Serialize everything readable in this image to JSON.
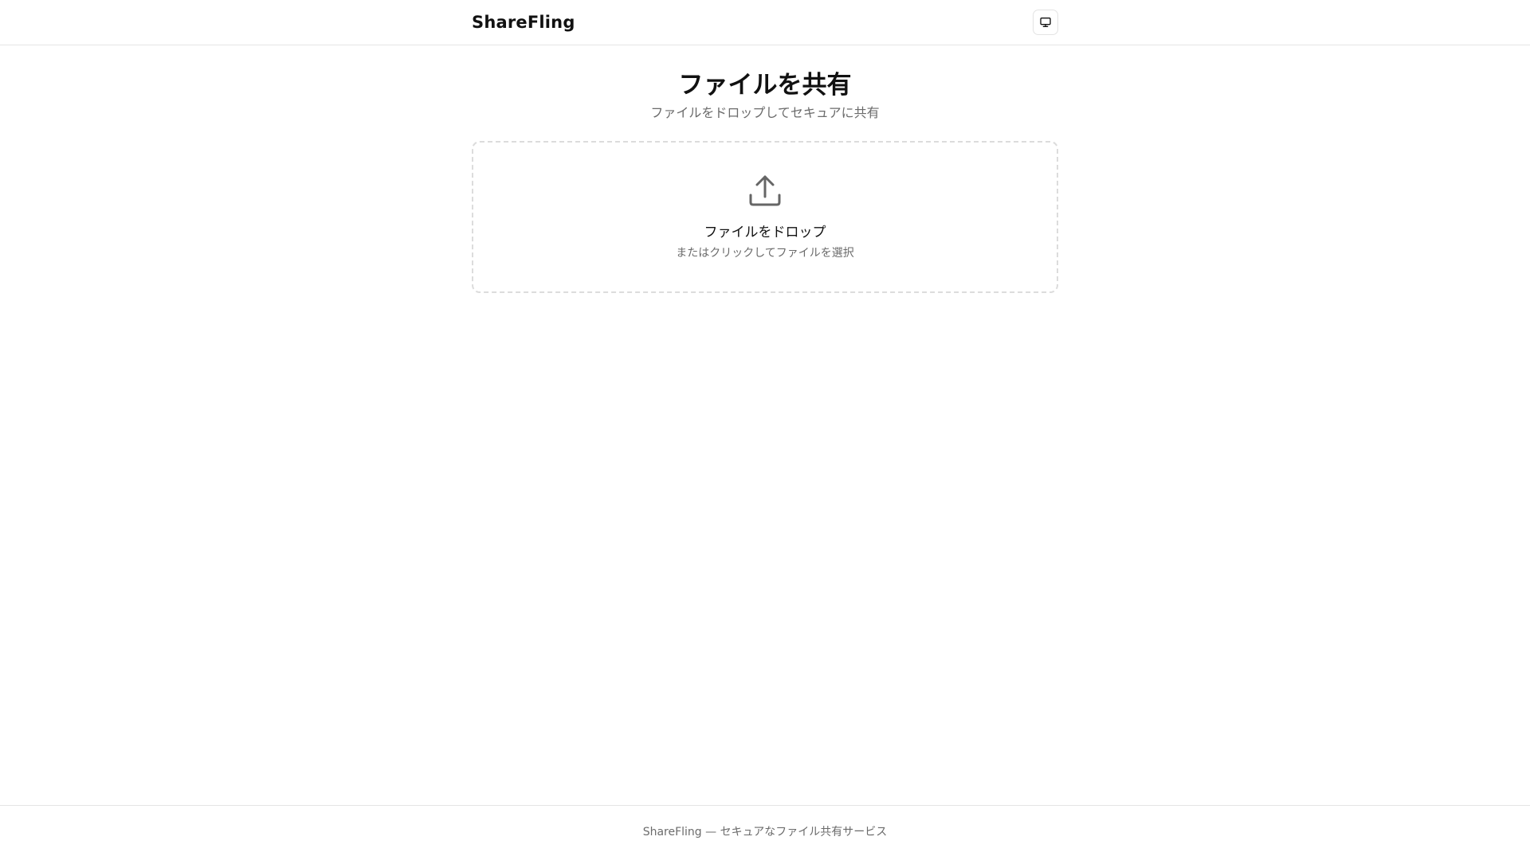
{
  "header": {
    "brand": "ShareFling",
    "theme_toggle_icon": "monitor-icon"
  },
  "main": {
    "title": "ファイルを共有",
    "subtitle": "ファイルをドロップしてセキュアに共有",
    "dropzone": {
      "icon": "upload-icon",
      "title": "ファイルをドロップ",
      "hint": "またはクリックしてファイルを選択"
    }
  },
  "footer": {
    "text": "ShareFling — セキュアなファイル共有サービス"
  },
  "colors": {
    "text_primary": "#111111",
    "text_muted": "#6b6b6b",
    "border": "#e5e5e5",
    "dropzone_border": "#dcdcdc",
    "background": "#ffffff"
  }
}
